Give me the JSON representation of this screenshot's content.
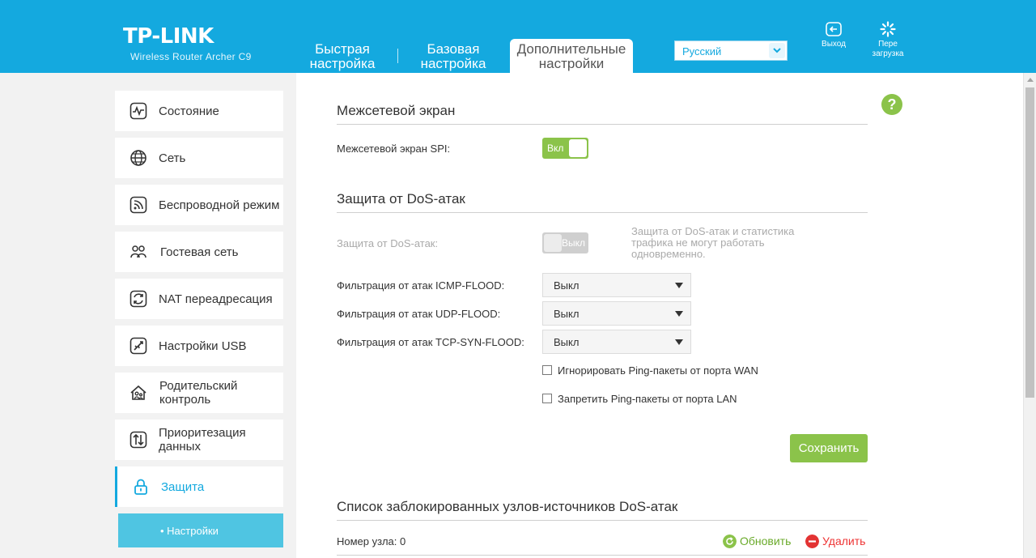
{
  "header": {
    "logo": "TP-LINK",
    "model": "Wireless Router Archer C9",
    "tabs": [
      {
        "label": "Быстрая настройка"
      },
      {
        "label": "Базовая настройка"
      },
      {
        "label": "Дополнительные настройки",
        "active": true
      }
    ],
    "language": "Русский",
    "exit_label": "Выход",
    "reboot_label": "Пере загрузка",
    "accent_color": "#14a9df"
  },
  "sidebar": {
    "items": [
      {
        "label": "Состояние",
        "icon": "status-icon"
      },
      {
        "label": "Сеть",
        "icon": "globe-icon"
      },
      {
        "label": "Беспроводной режим",
        "icon": "wireless-icon"
      },
      {
        "label": "Гостевая сеть",
        "icon": "guest-network-icon"
      },
      {
        "label": "NAT переадресация",
        "icon": "nat-icon"
      },
      {
        "label": "Настройки USB",
        "icon": "usb-icon"
      },
      {
        "label": "Родительский контроль",
        "icon": "parental-control-icon"
      },
      {
        "label": "Приоритезация данных",
        "icon": "qos-icon"
      },
      {
        "label": "Защита",
        "icon": "lock-icon",
        "active": true
      }
    ],
    "sub_item": "• Настройки"
  },
  "main": {
    "help": "?",
    "firewall": {
      "title": "Межсетевой экран",
      "spi_label": "Межсетевой экран SPI:",
      "spi_toggle": "Вкл",
      "spi_enabled": true
    },
    "dos": {
      "title": "Защита от DoS-атак",
      "protection_label": "Защита от DoS-атак:",
      "protection_toggle": "Выкл",
      "protection_enabled": false,
      "note": "Защита от DoS-атак и статистика трафика не могут работать одновременно.",
      "icmp_label": "Фильтрация от атак ICMP-FLOOD:",
      "icmp_value": "Выкл",
      "udp_label": "Фильтрация от атак UDP-FLOOD:",
      "udp_value": "Выкл",
      "tcp_label": "Фильтрация от атак TCP-SYN-FLOOD:",
      "tcp_value": "Выкл",
      "ignore_wan_ping": "Игнорировать Ping-пакеты от порта WAN",
      "ignore_wan_ping_checked": false,
      "forbid_lan_ping": "Запретить Ping-пакеты от порта LAN",
      "forbid_lan_ping_checked": false,
      "save_label": "Сохранить"
    },
    "blocked": {
      "title": "Список заблокированных узлов-источников DoS-атак",
      "count_label": "Номер узла:",
      "count_value": "0",
      "refresh_label": "Обновить",
      "delete_label": "Удалить"
    }
  },
  "colors": {
    "green": "#8bc34a",
    "red": "#e33333",
    "sub_item_bg": "#4fc5e2"
  }
}
